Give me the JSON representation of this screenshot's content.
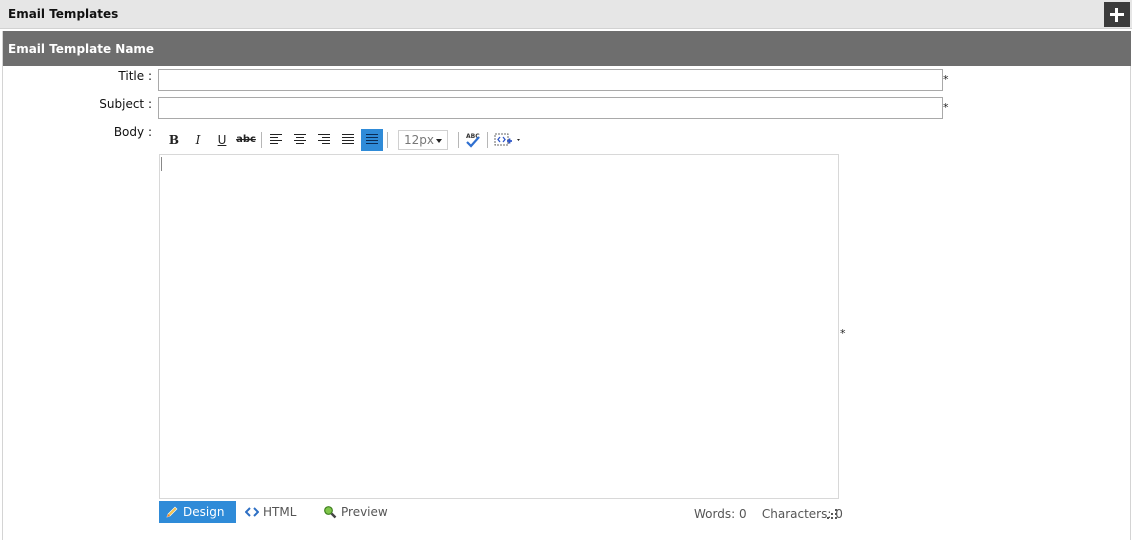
{
  "header": {
    "title": "Email Templates",
    "add_icon": "plus-icon"
  },
  "panel": {
    "title": "Email Template Name"
  },
  "form": {
    "title_label": "Title",
    "subject_label": "Subject",
    "body_label": "Body",
    "colon": ":",
    "required_mark": "*",
    "title_value": "",
    "subject_value": ""
  },
  "toolbar": {
    "bold": "B",
    "italic": "I",
    "underline": "U",
    "strike": "abc",
    "font_size": "12px",
    "icons": [
      "align-left-icon",
      "align-center-icon",
      "align-right-icon",
      "justify-icon",
      "justify-full-icon",
      "spellcheck-icon",
      "insert-snippet-icon"
    ]
  },
  "modes": {
    "design": "Design",
    "html": "HTML",
    "preview": "Preview"
  },
  "status": {
    "words_label": "Words:",
    "words": "0",
    "chars_label": "Characters:",
    "chars": "0"
  },
  "colors": {
    "accent": "#2f8bd8",
    "panel_header": "#6e6e6e",
    "topbar": "#e6e6e6"
  }
}
